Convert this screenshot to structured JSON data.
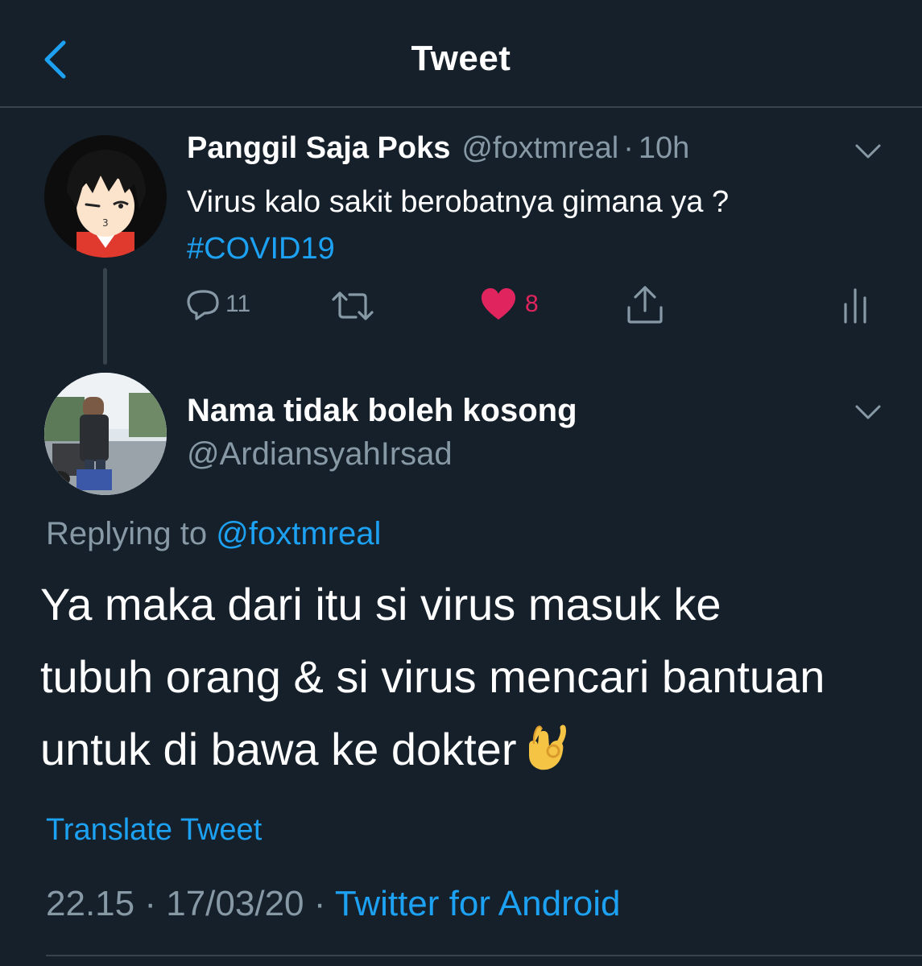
{
  "header": {
    "title": "Tweet",
    "back_icon": "chevron-left-icon"
  },
  "original_tweet": {
    "author_name": "Panggil Saja Poks",
    "author_handle": "@foxtmreal",
    "separator": "·",
    "age": "10h",
    "text": "Virus kalo sakit berobatnya gimana ya ?",
    "hashtag": "#COVID19",
    "actions": {
      "reply_count": "11",
      "like_count": "8",
      "like_color": "#e0245e"
    }
  },
  "reply_tweet": {
    "author_name": "Nama tidak boleh kosong",
    "author_handle": "@ArdiansyahIrsad",
    "replying_label": "Replying to",
    "replying_mention": "@foxtmreal",
    "text": "Ya maka dari itu si virus masuk ke tubuh orang & si virus mencari bantuan untuk di bawa ke dokter",
    "emoji": "ok-hand-icon",
    "translate_label": "Translate Tweet",
    "time": "22.15",
    "separator": "·",
    "date": "17/03/20",
    "source": "Twitter for Android"
  },
  "colors": {
    "background": "#15202b",
    "accent": "#1da1f2",
    "muted": "#8899a6",
    "divider": "#38444d"
  }
}
